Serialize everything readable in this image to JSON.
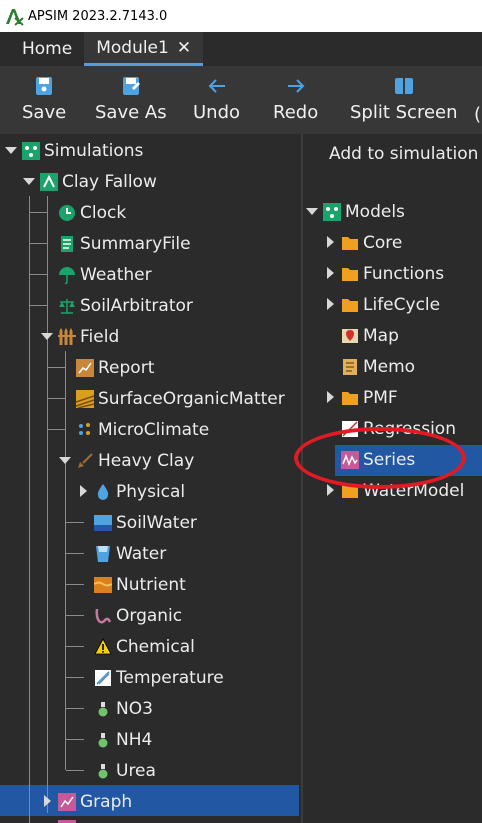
{
  "window": {
    "title": "APSIM 2023.2.7143.0"
  },
  "tabs": [
    {
      "label": "Home"
    },
    {
      "label": "Module1",
      "close": "✕"
    }
  ],
  "toolbar": {
    "save": "Save",
    "save_as": "Save As",
    "undo": "Undo",
    "redo": "Redo",
    "split": "Split Screen"
  },
  "tree": {
    "simulations": "Simulations",
    "clay_fallow": "Clay Fallow",
    "clock": "Clock",
    "summaryfile": "SummaryFile",
    "weather": "Weather",
    "soilarbitrator": "SoilArbitrator",
    "field": "Field",
    "report": "Report",
    "surfaceorganicmatter": "SurfaceOrganicMatter",
    "microclimate": "MicroClimate",
    "heavy_clay": "Heavy Clay",
    "physical": "Physical",
    "soilwater": "SoilWater",
    "water": "Water",
    "nutrient": "Nutrient",
    "organic": "Organic",
    "chemical": "Chemical",
    "temperature": "Temperature",
    "no3": "NO3",
    "nh4": "NH4",
    "urea": "Urea",
    "graph": "Graph"
  },
  "panel": {
    "header": "Add to simulation",
    "models": "Models",
    "core": "Core",
    "functions": "Functions",
    "lifecycle": "LifeCycle",
    "map": "Map",
    "memo": "Memo",
    "pmf": "PMF",
    "regression": "Regression",
    "series": "Series",
    "watermodel": "WaterModel"
  }
}
